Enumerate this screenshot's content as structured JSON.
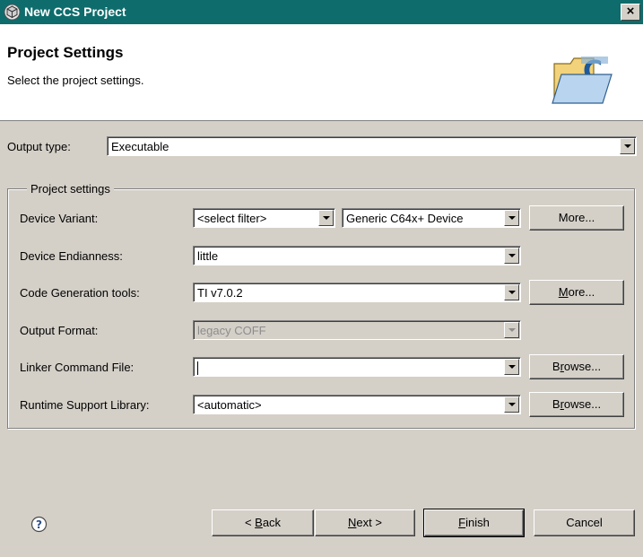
{
  "window": {
    "title": "New CCS Project",
    "close_label": "×"
  },
  "header": {
    "heading": "Project Settings",
    "description": "Select the project settings."
  },
  "output_type": {
    "label": "Output type:",
    "value": "Executable"
  },
  "project_settings": {
    "group_title": "Project settings",
    "device_variant": {
      "label": "Device Variant:",
      "filter_value": "<select filter>",
      "device_value": "Generic C64x+ Device",
      "more_label": "More..."
    },
    "device_endianness": {
      "label": "Device Endianness:",
      "value": "little"
    },
    "code_generation_tools": {
      "label": "Code Generation tools:",
      "value": "TI v7.0.2",
      "more_mnemonic": "M",
      "more_rest": "ore..."
    },
    "output_format": {
      "label": "Output Format:",
      "value": "legacy COFF"
    },
    "linker_command_file": {
      "label": "Linker Command File:",
      "value": "",
      "browse_prefix": "B",
      "browse_mnemonic": "r",
      "browse_rest": "owse..."
    },
    "runtime_support_library": {
      "label": "Runtime Support Library:",
      "value": "<automatic>",
      "browse_prefix": "B",
      "browse_mnemonic": "r",
      "browse_rest": "owse..."
    }
  },
  "footer": {
    "back_prefix": "< ",
    "back_mnemonic": "B",
    "back_rest": "ack",
    "next_mnemonic": "N",
    "next_rest": "ext >",
    "finish_mnemonic": "F",
    "finish_rest": "inish",
    "cancel_label": "Cancel"
  },
  "colors": {
    "titlebar": "#0e6c6c",
    "dialog_bg": "#d4d0c8",
    "header_bg": "#ffffff"
  },
  "icons": {
    "app": "cube-icon",
    "wizard": "folder-c-icon",
    "help": "help-icon"
  }
}
